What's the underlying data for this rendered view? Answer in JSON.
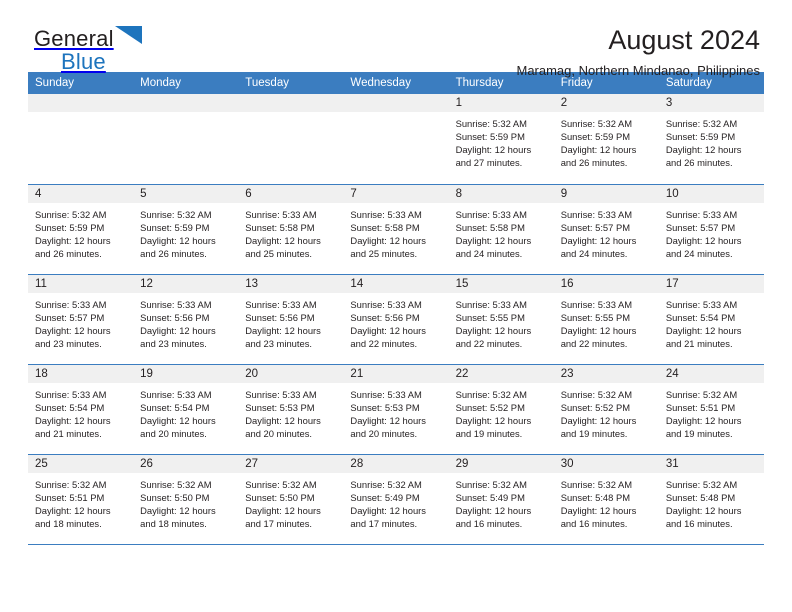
{
  "brand": {
    "name_part1": "General",
    "name_part2": "Blue",
    "logo_icon": "blue-triangle-logo"
  },
  "header": {
    "month_title": "August 2024",
    "location": "Maramag, Northern Mindanao, Philippines"
  },
  "colors": {
    "header_blue": "#3b7dc0",
    "brand_blue": "#1d74bd",
    "daynum_bg": "#f0f0f0",
    "text": "#231f20"
  },
  "calendar": {
    "weekday_headers": [
      "Sunday",
      "Monday",
      "Tuesday",
      "Wednesday",
      "Thursday",
      "Friday",
      "Saturday"
    ],
    "labels": {
      "sunrise_prefix": "Sunrise:",
      "sunset_prefix": "Sunset:",
      "daylight_prefix": "Daylight:"
    },
    "weeks": [
      [
        {
          "day": "",
          "sunrise": "",
          "sunset": "",
          "daylight_line1": "",
          "daylight_line2": ""
        },
        {
          "day": "",
          "sunrise": "",
          "sunset": "",
          "daylight_line1": "",
          "daylight_line2": ""
        },
        {
          "day": "",
          "sunrise": "",
          "sunset": "",
          "daylight_line1": "",
          "daylight_line2": ""
        },
        {
          "day": "",
          "sunrise": "",
          "sunset": "",
          "daylight_line1": "",
          "daylight_line2": ""
        },
        {
          "day": "1",
          "sunrise": "Sunrise: 5:32 AM",
          "sunset": "Sunset: 5:59 PM",
          "daylight_line1": "Daylight: 12 hours",
          "daylight_line2": "and 27 minutes."
        },
        {
          "day": "2",
          "sunrise": "Sunrise: 5:32 AM",
          "sunset": "Sunset: 5:59 PM",
          "daylight_line1": "Daylight: 12 hours",
          "daylight_line2": "and 26 minutes."
        },
        {
          "day": "3",
          "sunrise": "Sunrise: 5:32 AM",
          "sunset": "Sunset: 5:59 PM",
          "daylight_line1": "Daylight: 12 hours",
          "daylight_line2": "and 26 minutes."
        }
      ],
      [
        {
          "day": "4",
          "sunrise": "Sunrise: 5:32 AM",
          "sunset": "Sunset: 5:59 PM",
          "daylight_line1": "Daylight: 12 hours",
          "daylight_line2": "and 26 minutes."
        },
        {
          "day": "5",
          "sunrise": "Sunrise: 5:32 AM",
          "sunset": "Sunset: 5:59 PM",
          "daylight_line1": "Daylight: 12 hours",
          "daylight_line2": "and 26 minutes."
        },
        {
          "day": "6",
          "sunrise": "Sunrise: 5:33 AM",
          "sunset": "Sunset: 5:58 PM",
          "daylight_line1": "Daylight: 12 hours",
          "daylight_line2": "and 25 minutes."
        },
        {
          "day": "7",
          "sunrise": "Sunrise: 5:33 AM",
          "sunset": "Sunset: 5:58 PM",
          "daylight_line1": "Daylight: 12 hours",
          "daylight_line2": "and 25 minutes."
        },
        {
          "day": "8",
          "sunrise": "Sunrise: 5:33 AM",
          "sunset": "Sunset: 5:58 PM",
          "daylight_line1": "Daylight: 12 hours",
          "daylight_line2": "and 24 minutes."
        },
        {
          "day": "9",
          "sunrise": "Sunrise: 5:33 AM",
          "sunset": "Sunset: 5:57 PM",
          "daylight_line1": "Daylight: 12 hours",
          "daylight_line2": "and 24 minutes."
        },
        {
          "day": "10",
          "sunrise": "Sunrise: 5:33 AM",
          "sunset": "Sunset: 5:57 PM",
          "daylight_line1": "Daylight: 12 hours",
          "daylight_line2": "and 24 minutes."
        }
      ],
      [
        {
          "day": "11",
          "sunrise": "Sunrise: 5:33 AM",
          "sunset": "Sunset: 5:57 PM",
          "daylight_line1": "Daylight: 12 hours",
          "daylight_line2": "and 23 minutes."
        },
        {
          "day": "12",
          "sunrise": "Sunrise: 5:33 AM",
          "sunset": "Sunset: 5:56 PM",
          "daylight_line1": "Daylight: 12 hours",
          "daylight_line2": "and 23 minutes."
        },
        {
          "day": "13",
          "sunrise": "Sunrise: 5:33 AM",
          "sunset": "Sunset: 5:56 PM",
          "daylight_line1": "Daylight: 12 hours",
          "daylight_line2": "and 23 minutes."
        },
        {
          "day": "14",
          "sunrise": "Sunrise: 5:33 AM",
          "sunset": "Sunset: 5:56 PM",
          "daylight_line1": "Daylight: 12 hours",
          "daylight_line2": "and 22 minutes."
        },
        {
          "day": "15",
          "sunrise": "Sunrise: 5:33 AM",
          "sunset": "Sunset: 5:55 PM",
          "daylight_line1": "Daylight: 12 hours",
          "daylight_line2": "and 22 minutes."
        },
        {
          "day": "16",
          "sunrise": "Sunrise: 5:33 AM",
          "sunset": "Sunset: 5:55 PM",
          "daylight_line1": "Daylight: 12 hours",
          "daylight_line2": "and 22 minutes."
        },
        {
          "day": "17",
          "sunrise": "Sunrise: 5:33 AM",
          "sunset": "Sunset: 5:54 PM",
          "daylight_line1": "Daylight: 12 hours",
          "daylight_line2": "and 21 minutes."
        }
      ],
      [
        {
          "day": "18",
          "sunrise": "Sunrise: 5:33 AM",
          "sunset": "Sunset: 5:54 PM",
          "daylight_line1": "Daylight: 12 hours",
          "daylight_line2": "and 21 minutes."
        },
        {
          "day": "19",
          "sunrise": "Sunrise: 5:33 AM",
          "sunset": "Sunset: 5:54 PM",
          "daylight_line1": "Daylight: 12 hours",
          "daylight_line2": "and 20 minutes."
        },
        {
          "day": "20",
          "sunrise": "Sunrise: 5:33 AM",
          "sunset": "Sunset: 5:53 PM",
          "daylight_line1": "Daylight: 12 hours",
          "daylight_line2": "and 20 minutes."
        },
        {
          "day": "21",
          "sunrise": "Sunrise: 5:33 AM",
          "sunset": "Sunset: 5:53 PM",
          "daylight_line1": "Daylight: 12 hours",
          "daylight_line2": "and 20 minutes."
        },
        {
          "day": "22",
          "sunrise": "Sunrise: 5:32 AM",
          "sunset": "Sunset: 5:52 PM",
          "daylight_line1": "Daylight: 12 hours",
          "daylight_line2": "and 19 minutes."
        },
        {
          "day": "23",
          "sunrise": "Sunrise: 5:32 AM",
          "sunset": "Sunset: 5:52 PM",
          "daylight_line1": "Daylight: 12 hours",
          "daylight_line2": "and 19 minutes."
        },
        {
          "day": "24",
          "sunrise": "Sunrise: 5:32 AM",
          "sunset": "Sunset: 5:51 PM",
          "daylight_line1": "Daylight: 12 hours",
          "daylight_line2": "and 19 minutes."
        }
      ],
      [
        {
          "day": "25",
          "sunrise": "Sunrise: 5:32 AM",
          "sunset": "Sunset: 5:51 PM",
          "daylight_line1": "Daylight: 12 hours",
          "daylight_line2": "and 18 minutes."
        },
        {
          "day": "26",
          "sunrise": "Sunrise: 5:32 AM",
          "sunset": "Sunset: 5:50 PM",
          "daylight_line1": "Daylight: 12 hours",
          "daylight_line2": "and 18 minutes."
        },
        {
          "day": "27",
          "sunrise": "Sunrise: 5:32 AM",
          "sunset": "Sunset: 5:50 PM",
          "daylight_line1": "Daylight: 12 hours",
          "daylight_line2": "and 17 minutes."
        },
        {
          "day": "28",
          "sunrise": "Sunrise: 5:32 AM",
          "sunset": "Sunset: 5:49 PM",
          "daylight_line1": "Daylight: 12 hours",
          "daylight_line2": "and 17 minutes."
        },
        {
          "day": "29",
          "sunrise": "Sunrise: 5:32 AM",
          "sunset": "Sunset: 5:49 PM",
          "daylight_line1": "Daylight: 12 hours",
          "daylight_line2": "and 16 minutes."
        },
        {
          "day": "30",
          "sunrise": "Sunrise: 5:32 AM",
          "sunset": "Sunset: 5:48 PM",
          "daylight_line1": "Daylight: 12 hours",
          "daylight_line2": "and 16 minutes."
        },
        {
          "day": "31",
          "sunrise": "Sunrise: 5:32 AM",
          "sunset": "Sunset: 5:48 PM",
          "daylight_line1": "Daylight: 12 hours",
          "daylight_line2": "and 16 minutes."
        }
      ]
    ]
  }
}
